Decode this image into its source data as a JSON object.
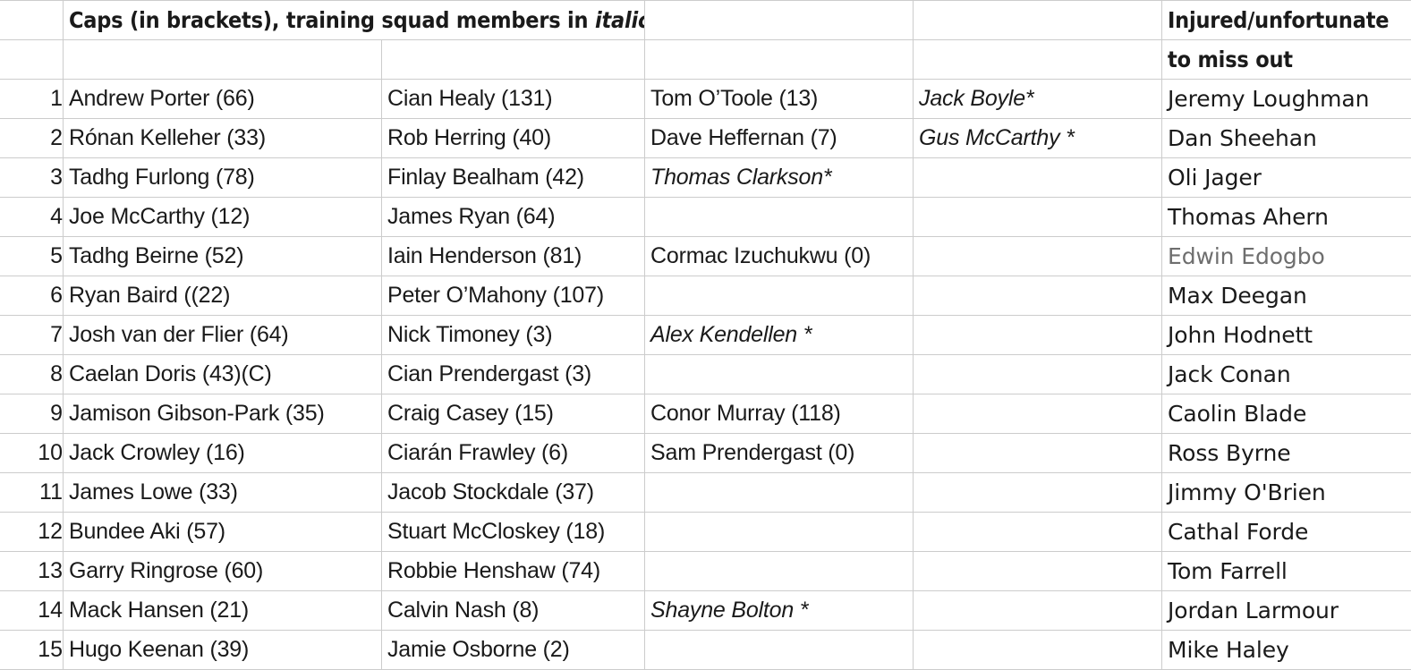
{
  "table": {
    "header": {
      "caps_note_plain": "Caps (in brackets), training squad members in ",
      "caps_note_italic": "italics.",
      "injured_line1": "Injured/unfortunate",
      "injured_line2": "to miss out"
    },
    "rows": [
      {
        "num": "1",
        "p1": "Andrew Porter (66)",
        "p2": "Cian Healy (131)",
        "p3": "Tom O’Toole (13)",
        "p4": "Jack Boyle*",
        "p4_italic": true,
        "injured": "Jeremy Loughman"
      },
      {
        "num": "2",
        "p1": "Rónan Kelleher (33)",
        "p2": "Rob Herring (40)",
        "p3": "Dave Heffernan (7)",
        "p4": "Gus McCarthy *",
        "p4_italic": true,
        "injured": "Dan Sheehan"
      },
      {
        "num": "3",
        "p1": "Tadhg Furlong (78)",
        "p2": "Finlay Bealham (42)",
        "p3": "Thomas Clarkson*",
        "p3_italic": true,
        "p4": "",
        "injured": "Oli Jager"
      },
      {
        "num": "4",
        "p1": "Joe McCarthy (12)",
        "p2": "James Ryan (64)",
        "p3": "",
        "p4": "",
        "injured": "Thomas Ahern"
      },
      {
        "num": "5",
        "p1": "Tadhg Beirne (52)",
        "p2": "Iain Henderson (81)",
        "p3": "Cormac Izuchukwu (0)",
        "p4": "",
        "injured": "Edwin Edogbo",
        "injured_dim": true
      },
      {
        "num": "6",
        "p1": "Ryan Baird ((22)",
        "p2": "Peter O’Mahony (107)",
        "p3": "",
        "p4": "",
        "injured": "Max Deegan"
      },
      {
        "num": "7",
        "p1": "Josh van der Flier (64)",
        "p2": "Nick Timoney (3)",
        "p3": "Alex Kendellen *",
        "p3_italic": true,
        "p4": "",
        "injured": "John Hodnett"
      },
      {
        "num": "8",
        "p1": "Caelan Doris (43)(C)",
        "p2": "Cian Prendergast (3)",
        "p3": "",
        "p4": "",
        "injured": "Jack Conan"
      },
      {
        "num": "9",
        "p1": "Jamison Gibson-Park (35)",
        "p2": "Craig Casey (15)",
        "p3": "Conor Murray (118)",
        "p4": "",
        "injured": "Caolin Blade"
      },
      {
        "num": "10",
        "p1": "Jack Crowley (16)",
        "p2": "Ciarán Frawley (6)",
        "p3": "Sam Prendergast (0)",
        "p4": "",
        "injured": "Ross Byrne"
      },
      {
        "num": "11",
        "p1": "James Lowe (33)",
        "p2": "Jacob Stockdale (37)",
        "p3": "",
        "p4": "",
        "injured": "Jimmy O'Brien"
      },
      {
        "num": "12",
        "p1": "Bundee Aki (57)",
        "p2": "Stuart McCloskey (18)",
        "p3": "",
        "p4": "",
        "injured": "Cathal Forde"
      },
      {
        "num": "13",
        "p1": "Garry Ringrose (60)",
        "p2": "Robbie Henshaw (74)",
        "p3": "",
        "p4": "",
        "injured": "Tom Farrell"
      },
      {
        "num": "14",
        "p1": "Mack Hansen (21)",
        "p2": "Calvin Nash (8)",
        "p3": "Shayne Bolton *",
        "p3_italic": true,
        "p4": "",
        "injured": "Jordan Larmour"
      },
      {
        "num": "15",
        "p1": "Hugo Keenan (39)",
        "p2": "Jamie Osborne (2)",
        "p3": "",
        "p4": "",
        "injured": "Mike Haley"
      }
    ]
  }
}
